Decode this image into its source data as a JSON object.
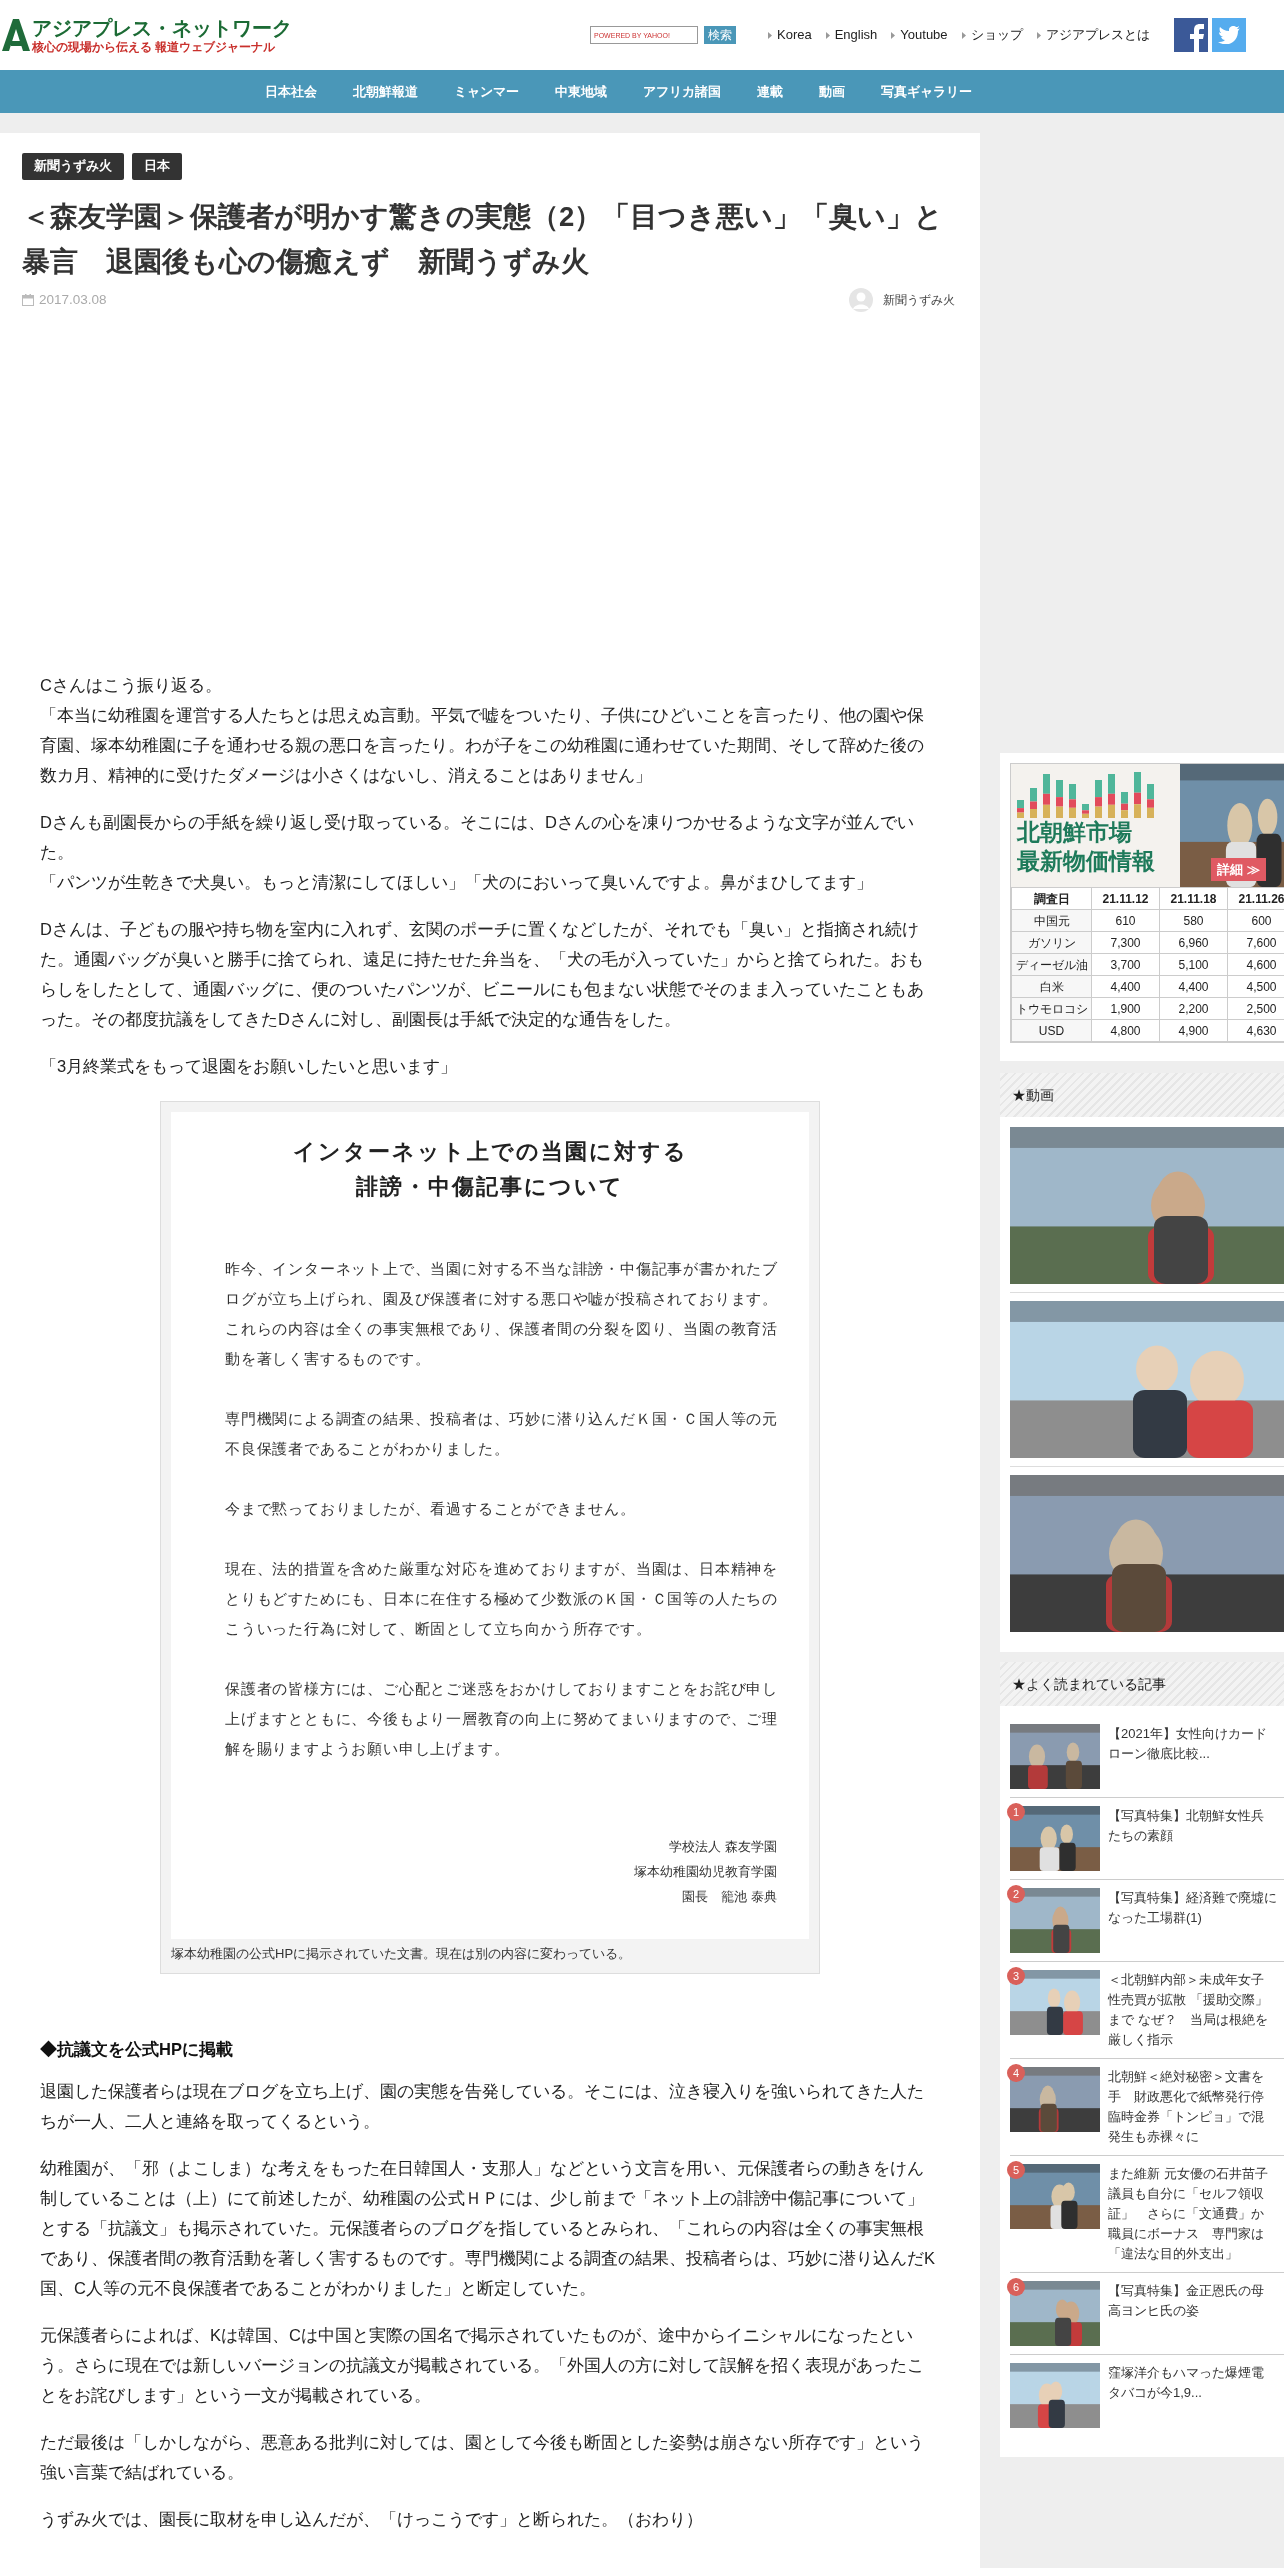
{
  "header": {
    "logo": {
      "title": "アジアプレス・ネットワーク",
      "tagline": "核心の現場から伝える 報道ウェブジャーナル"
    },
    "search": {
      "placeholder": "POWERED BY YAHOO!",
      "button": "検索"
    },
    "links": [
      "Korea",
      "English",
      "Youtube",
      "ショップ",
      "アジアプレスとは"
    ]
  },
  "nav": [
    "日本社会",
    "北朝鮮報道",
    "ミャンマー",
    "中東地域",
    "アフリカ諸国",
    "連載",
    "動画",
    "写真ギャラリー"
  ],
  "article": {
    "tags": [
      "新聞うずみ火",
      "日本"
    ],
    "title": "＜森友学園＞保護者が明かす驚きの実態（2）「目つき悪い」「臭い」と暴言　退園後も心の傷癒えず　新聞うずみ火",
    "date": "2017.03.08",
    "author": "新聞うずみ火",
    "blocks": [
      {
        "kind": "paragraph",
        "lines": [
          "Cさんはこう振り返る。",
          "「本当に幼稚園を運営する人たちとは思えぬ言動。平気で嘘をついたり、子供にひどいことを言ったり、他の園や保育園、塚本幼稚園に子を通わせる親の悪口を言ったり。わが子をこの幼稚園に通わせていた期間、そして辞めた後の数カ月、精神的に受けたダメージは小さくはないし、消えることはありません」"
        ]
      },
      {
        "kind": "paragraph",
        "lines": [
          "Dさんも副園長からの手紙を繰り返し受け取っている。そこには、Dさんの心を凍りつかせるような文字が並んでいた。",
          "「パンツが生乾きで犬臭い。もっと清潔にしてほしい」「犬のにおいって臭いんですよ。鼻がまひしてます」"
        ]
      },
      {
        "kind": "paragraph",
        "lines": [
          "Dさんは、子どもの服や持ち物を室内に入れず、玄関のポーチに置くなどしたが、それでも「臭い」と指摘され続けた。通園バッグが臭いと勝手に捨てられ、遠足に持たせた弁当を、「犬の毛が入っていた」からと捨てられた。おもらしをしたとして、通園バッグに、便のついたパンツが、ビニールにも包まない状態でそのまま入っていたこともあった。その都度抗議をしてきたDさんに対し、副園長は手紙で決定的な通告をした。"
        ]
      },
      {
        "kind": "paragraph",
        "lines": [
          "「3月終業式をもって退園をお願いしたいと思います」"
        ]
      },
      {
        "kind": "figure",
        "document": {
          "title_lines": [
            "インターネット上での当園に対する",
            "誹謗・中傷記事について"
          ],
          "paragraphs": [
            "昨今、インターネット上で、当園に対する不当な誹謗・中傷記事が書かれたブログが立ち上げられ、園及び保護者に対する悪口や嘘が投稿されております。これらの内容は全くの事実無根であり、保護者間の分裂を図り、当園の教育活動を著しく害するものです。",
            "専門機関による調査の結果、投稿者は、巧妙に潜り込んだＫ国・Ｃ国人等の元不良保護者であることがわかりました。",
            "今まで黙っておりましたが、看過することができません。",
            "現在、法的措置を含めた厳重な対応を進めておりますが、当園は、日本精神をとりもどすためにも、日本に在住する極めて少数派のＫ国・Ｃ国等の人たちのこういった行為に対して、断固として立ち向かう所存です。",
            "保護者の皆様方には、ご心配とご迷惑をおかけしておりますことをお詫び申し上げますとともに、今後もより一層教育の向上に努めてまいりますので、ご理解を賜りますようお願い申し上げます。"
          ],
          "signature": [
            "学校法人 森友学園",
            "塚本幼稚園幼児教育学園",
            "園長　籠池 泰典"
          ]
        },
        "caption": "塚本幼稚園の公式HPに掲示されていた文書。現在は別の内容に変わっている。"
      },
      {
        "kind": "heading",
        "lines": [
          "◆抗議文を公式HPに掲載"
        ]
      },
      {
        "kind": "paragraph",
        "lines": [
          "退園した保護者らは現在ブログを立ち上げ、園の実態を告発している。そこには、泣き寝入りを強いられてきた人たちが一人、二人と連絡を取ってくるという。"
        ]
      },
      {
        "kind": "paragraph",
        "lines": [
          "幼稚園が、「邪（よこしま）な考えをもった在日韓国人・支那人」などという文言を用い、元保護者らの動きをけん制していることは（上）にて前述したが、幼稚園の公式ＨＰには、少し前まで「ネット上の誹謗中傷記事について」とする「抗議文」も掲示されていた。元保護者らのブログを指しているとみられ、「これらの内容は全くの事実無根であり、保護者間の教育活動を著しく害するものです。専門機関による調査の結果、投稿者らは、巧妙に潜り込んだK国、C人等の元不良保護者であることがわかりました」と断定していた。"
        ]
      },
      {
        "kind": "paragraph",
        "lines": [
          "元保護者らによれば、Kは韓国、Cは中国と実際の国名で掲示されていたものが、途中からイニシャルになったという。さらに現在では新しいバージョンの抗議文が掲載されている。「外国人の方に対して誤解を招く表現があったことをお詫びします」という一文が掲載されている。"
        ]
      },
      {
        "kind": "paragraph",
        "lines": [
          "ただ最後は「しかしながら、悪意ある批判に対しては、園として今後も断固とした姿勢は崩さない所存です」という強い言葉で結ばれている。"
        ]
      },
      {
        "kind": "paragraph",
        "lines": [
          "うずみ火では、園長に取材を申し込んだが、「けっこうです」と断られた。（おわり）"
        ]
      }
    ]
  },
  "sidebar": {
    "market": {
      "banner_lines": [
        "北朝鮮市場",
        "最新物価情報"
      ],
      "banner_button": "詳細 ≫",
      "columns": [
        "調査日",
        "21.11.12",
        "21.11.18",
        "21.11.26"
      ],
      "rows": [
        [
          "中国元",
          "610",
          "580",
          "600"
        ],
        [
          "ガソリン",
          "7,300",
          "6,960",
          "7,600"
        ],
        [
          "ディーゼル油",
          "3,700",
          "5,100",
          "4,600"
        ],
        [
          "白米",
          "4,400",
          "4,400",
          "4,500"
        ],
        [
          "トウモロコシ",
          "1,900",
          "2,200",
          "2,500"
        ],
        [
          "USD",
          "4,800",
          "4,900",
          "4,630"
        ]
      ]
    },
    "videos": {
      "title": "★動画"
    },
    "popular": {
      "title": "★よく読まれている記事",
      "items": [
        {
          "lines": [
            "【2021年】女性向けカード",
            "ローン徹底比較..."
          ]
        },
        {
          "rank": "1",
          "lines": [
            "【写真特集】北朝鮮女性兵",
            "たちの素顔"
          ]
        },
        {
          "rank": "2",
          "lines": [
            "【写真特集】経済難で廃墟に",
            "なった工場群(1)"
          ]
        },
        {
          "rank": "3",
          "lines": [
            "＜北朝鮮内部＞未成年女子",
            "性売買が拡散 「援助交際」",
            "まで なぜ？　当局は根絶を",
            "厳しく指示"
          ]
        },
        {
          "rank": "4",
          "lines": [
            "北朝鮮＜絶対秘密＞文書を",
            "手　財政悪化で紙幣発行停",
            "臨時金券「トンピョ」で混",
            "発生も赤裸々に"
          ]
        },
        {
          "rank": "5",
          "lines": [
            "また維新 元女優の石井苗子",
            "議員も自分に「セルフ領収",
            "証」　さらに「文通費」か",
            "職員にボーナス　専門家は",
            "「違法な目的外支出」"
          ]
        },
        {
          "rank": "6",
          "lines": [
            "【写真特集】金正恩氏の母",
            "高ヨンヒ氏の姿"
          ]
        },
        {
          "lines": [
            "窪塚洋介もハマった爆煙電",
            "タバコが今1,9..."
          ]
        }
      ]
    }
  }
}
